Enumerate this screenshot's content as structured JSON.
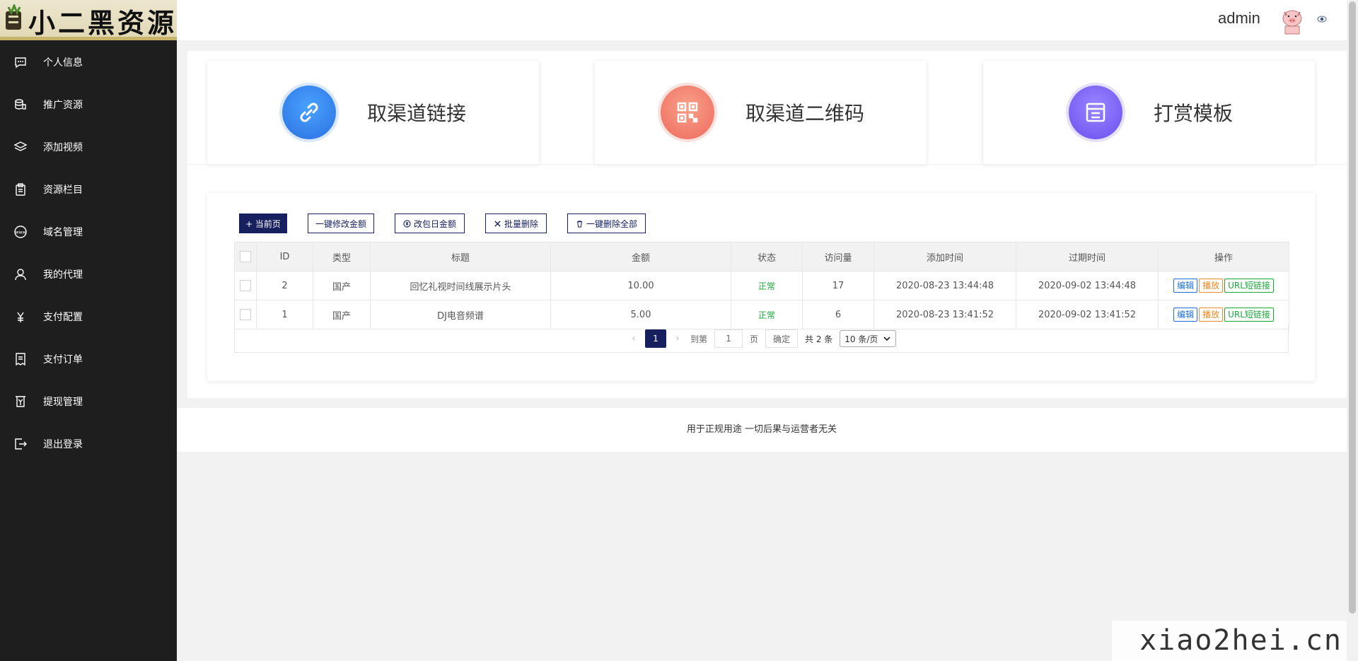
{
  "logo": {
    "text": "小二黑资源网"
  },
  "sidebar": {
    "items": [
      {
        "label": "个人信息",
        "icon": "message-icon"
      },
      {
        "label": "推广资源",
        "icon": "coins-icon"
      },
      {
        "label": "添加视频",
        "icon": "layers-icon"
      },
      {
        "label": "资源栏目",
        "icon": "clipboard-icon"
      },
      {
        "label": "域名管理",
        "icon": "www-icon"
      },
      {
        "label": "我的代理",
        "icon": "user-icon"
      },
      {
        "label": "支付配置",
        "icon": "yen-icon"
      },
      {
        "label": "支付订单",
        "icon": "receipt-icon"
      },
      {
        "label": "提现管理",
        "icon": "withdraw-icon"
      },
      {
        "label": "退出登录",
        "icon": "logout-icon"
      }
    ]
  },
  "header": {
    "username": "admin"
  },
  "cards": [
    {
      "title": "取渠道链接",
      "icon": "link-icon",
      "color": "#3a8ff0"
    },
    {
      "title": "取渠道二维码",
      "icon": "qrcode-icon",
      "color": "#f0786a"
    },
    {
      "title": "打赏模板",
      "icon": "template-icon",
      "color": "#7b63f2"
    }
  ],
  "toolbar": {
    "btn_current": "+ 当前页",
    "btn_batch_amount": "一键修改金额",
    "btn_package_amount": "改包日金额",
    "btn_batch_delete": "批量删除",
    "btn_delete_all": "一键删除全部"
  },
  "table": {
    "headers": [
      "ID",
      "类型",
      "标题",
      "金额",
      "状态",
      "访问量",
      "添加时间",
      "过期时间",
      "操作"
    ],
    "rows": [
      {
        "id": "2",
        "type": "国产",
        "title": "回忆礼视时间线展示片头",
        "amount": "10.00",
        "status": "正常",
        "visits": "17",
        "added": "2020-08-23 13:44:48",
        "expires": "2020-09-02 13:44:48"
      },
      {
        "id": "1",
        "type": "国产",
        "title": "DJ电音频谱",
        "amount": "5.00",
        "status": "正常",
        "visits": "6",
        "added": "2020-08-23 13:41:52",
        "expires": "2020-09-02 13:41:52"
      }
    ],
    "actions": {
      "edit": "编辑",
      "play": "播放",
      "url": "URL短链接"
    }
  },
  "pager": {
    "current": "1",
    "goto_label": "到第",
    "goto_value": "1",
    "page_unit": "页",
    "confirm": "确定",
    "total": "共 2 条",
    "page_size": "10 条/页"
  },
  "footer": {
    "text": "用于正规用途 一切后果与运营者无关"
  },
  "watermark": {
    "text": "xiao2hei.cn"
  },
  "colors": {
    "sidebar": "#1e1e1e",
    "primary": "#16205e",
    "ok": "#19a83a"
  }
}
